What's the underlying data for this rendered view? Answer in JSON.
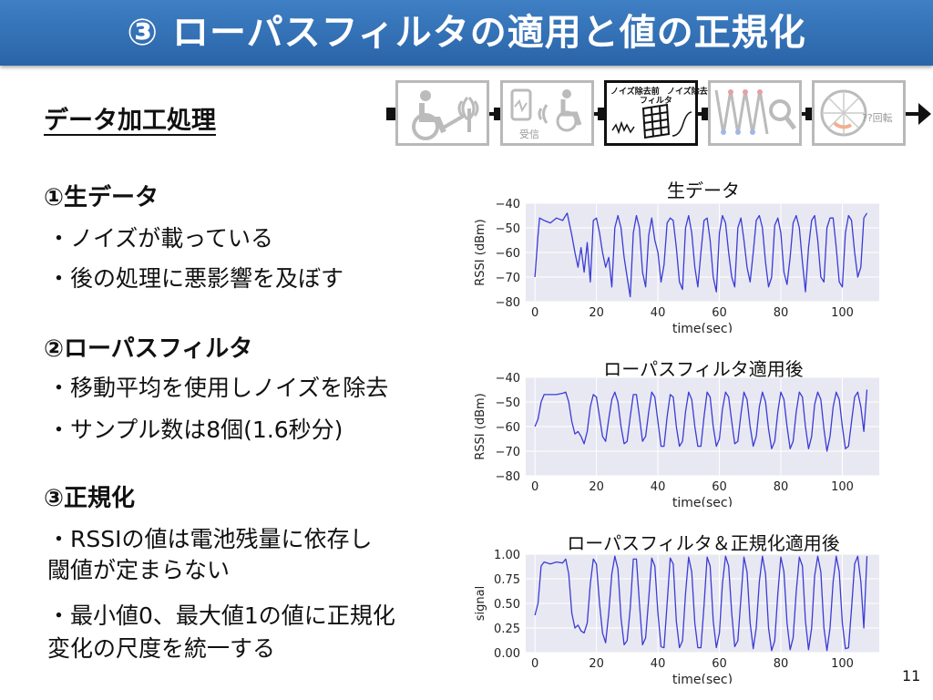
{
  "title": "③ ローパスフィルタの適用と値の正規化",
  "subtitle": "データ加工処理",
  "pipeline": {
    "stage2_label": "受信",
    "stage3_labels": [
      "ノイズ除去前",
      "フィルタ",
      "ノイズ除去後"
    ],
    "stage5_label": "??回転"
  },
  "sections": [
    {
      "heading": "①生データ",
      "bullets": [
        "・ノイズが載っている",
        "・後の処理に悪影響を及ぼす"
      ]
    },
    {
      "heading": "②ローパスフィルタ",
      "bullets": [
        "・移動平均を使用しノイズを除去",
        "・サンプル数は8個(1.6秒分)"
      ]
    },
    {
      "heading": "③正規化",
      "bullets": [
        "・RSSIの値は電池残量に依存し",
        "  閾値が定まらない",
        "・最小値0、最大値1の値に正規化",
        "  変化の尺度を統一する"
      ]
    }
  ],
  "page_number": "11",
  "colors": {
    "title_bar": "#3570b8",
    "line": "#3b3bd6",
    "plot_bg": "#e8e8f2"
  },
  "chart_data": [
    {
      "type": "line",
      "title": "生データ",
      "xlabel": "time(sec)",
      "ylabel": "RSSI (dBm)",
      "xlim": [
        -3,
        112
      ],
      "ylim": [
        -80,
        -40
      ],
      "xticks": [
        0,
        20,
        40,
        60,
        80,
        100
      ],
      "yticks": [
        -40,
        -50,
        -60,
        -70,
        -80
      ],
      "grid": true,
      "x": [
        0,
        1,
        1.5,
        3,
        5,
        7,
        9,
        10.5,
        12,
        13,
        14,
        15,
        16,
        17,
        18,
        19,
        20,
        21,
        22,
        23,
        24,
        25,
        26,
        27,
        28,
        29,
        30,
        31,
        32,
        33,
        34,
        35,
        36,
        37,
        38,
        39,
        40,
        41,
        42,
        43,
        44,
        45,
        46,
        47,
        48,
        49,
        50,
        51,
        52,
        53,
        54,
        55,
        56,
        57,
        58,
        59,
        60,
        61,
        62,
        63,
        64,
        65,
        66,
        67,
        68,
        69,
        70,
        71,
        72,
        73,
        74,
        75,
        76,
        77,
        78,
        79,
        80,
        81,
        82,
        83,
        84,
        85,
        86,
        87,
        88,
        89,
        90,
        91,
        92,
        93,
        94,
        95,
        96,
        97,
        98,
        99,
        100,
        101,
        102,
        103,
        104,
        105,
        106,
        107,
        108
      ],
      "y": [
        -70,
        -53,
        -46,
        -47,
        -48,
        -46,
        -47,
        -44,
        -53,
        -60,
        -66,
        -58,
        -68,
        -56,
        -72,
        -47,
        -46,
        -52,
        -60,
        -66,
        -62,
        -74,
        -50,
        -45,
        -50,
        -62,
        -70,
        -78,
        -52,
        -45,
        -50,
        -68,
        -74,
        -53,
        -46,
        -55,
        -60,
        -72,
        -65,
        -48,
        -46,
        -47,
        -58,
        -72,
        -75,
        -50,
        -45,
        -52,
        -66,
        -74,
        -60,
        -47,
        -46,
        -55,
        -70,
        -76,
        -52,
        -45,
        -48,
        -60,
        -70,
        -74,
        -50,
        -46,
        -55,
        -66,
        -72,
        -60,
        -47,
        -45,
        -50,
        -64,
        -74,
        -70,
        -49,
        -46,
        -52,
        -68,
        -73,
        -62,
        -48,
        -45,
        -50,
        -64,
        -76,
        -58,
        -47,
        -45,
        -55,
        -70,
        -72,
        -50,
        -46,
        -46,
        -58,
        -72,
        -74,
        -52,
        -45,
        -47,
        -60,
        -70,
        -66,
        -46,
        -44,
        -47,
        -55
      ]
    },
    {
      "type": "line",
      "title": "ローパスフィルタ適用後",
      "xlabel": "time(sec)",
      "ylabel": "RSSI (dBm)",
      "xlim": [
        -3,
        112
      ],
      "ylim": [
        -80,
        -40
      ],
      "xticks": [
        0,
        20,
        40,
        60,
        80,
        100
      ],
      "yticks": [
        -40,
        -50,
        -60,
        -70,
        -80
      ],
      "grid": true,
      "x": [
        0,
        1,
        2,
        3,
        5,
        7,
        9,
        10,
        11,
        12,
        13,
        14,
        15,
        16,
        17,
        18,
        19,
        20,
        21,
        22,
        23,
        24,
        25,
        26,
        27,
        28,
        29,
        30,
        31,
        32,
        33,
        34,
        35,
        36,
        37,
        38,
        39,
        40,
        41,
        42,
        43,
        44,
        45,
        46,
        47,
        48,
        49,
        50,
        51,
        52,
        53,
        54,
        55,
        56,
        57,
        58,
        59,
        60,
        61,
        62,
        63,
        64,
        65,
        66,
        67,
        68,
        69,
        70,
        71,
        72,
        73,
        74,
        75,
        76,
        77,
        78,
        79,
        80,
        81,
        82,
        83,
        84,
        85,
        86,
        87,
        88,
        89,
        90,
        91,
        92,
        93,
        94,
        95,
        96,
        97,
        98,
        99,
        100,
        101,
        102,
        103,
        104,
        105,
        106,
        107,
        108
      ],
      "y": [
        -60,
        -57,
        -50,
        -47,
        -47,
        -47,
        -46.5,
        -46,
        -50,
        -58,
        -63,
        -62,
        -64,
        -67,
        -62,
        -52,
        -47,
        -48,
        -56,
        -64,
        -66,
        -57,
        -49,
        -46,
        -50,
        -60,
        -67,
        -66,
        -56,
        -47,
        -47,
        -56,
        -66,
        -64,
        -54,
        -46,
        -48,
        -58,
        -68,
        -68,
        -56,
        -47,
        -48,
        -60,
        -68,
        -66,
        -54,
        -46,
        -49,
        -60,
        -68,
        -68,
        -56,
        -46,
        -48,
        -60,
        -68,
        -65,
        -53,
        -46,
        -48,
        -58,
        -67,
        -66,
        -55,
        -46,
        -49,
        -60,
        -68,
        -64,
        -52,
        -46,
        -50,
        -61,
        -69,
        -66,
        -54,
        -46,
        -49,
        -60,
        -69,
        -66,
        -54,
        -46,
        -48,
        -60,
        -69,
        -64,
        -51,
        -46,
        -49,
        -61,
        -70,
        -64,
        -52,
        -46,
        -49,
        -60,
        -69,
        -68,
        -58,
        -48,
        -46,
        -52,
        -62,
        -45
      ]
    },
    {
      "type": "line",
      "title": "ローパスフィルタ＆正規化適用後",
      "xlabel": "time(sec)",
      "ylabel": "signal",
      "xlim": [
        -3,
        112
      ],
      "ylim": [
        0,
        1
      ],
      "xticks": [
        0,
        20,
        40,
        60,
        80,
        100
      ],
      "yticks": [
        1.0,
        0.75,
        0.5,
        0.25,
        0.0
      ],
      "ytick_labels": [
        "1.00",
        "0.75",
        "0.50",
        "0.25",
        "0.00"
      ],
      "grid": true,
      "x": [
        0,
        1,
        2,
        3,
        5,
        7,
        9,
        10,
        11,
        12,
        13,
        14,
        15,
        16,
        17,
        18,
        19,
        20,
        21,
        22,
        23,
        24,
        25,
        26,
        27,
        28,
        29,
        30,
        31,
        32,
        33,
        34,
        35,
        36,
        37,
        38,
        39,
        40,
        41,
        42,
        43,
        44,
        45,
        46,
        47,
        48,
        49,
        50,
        51,
        52,
        53,
        54,
        55,
        56,
        57,
        58,
        59,
        60,
        61,
        62,
        63,
        64,
        65,
        66,
        67,
        68,
        69,
        70,
        71,
        72,
        73,
        74,
        75,
        76,
        77,
        78,
        79,
        80,
        81,
        82,
        83,
        84,
        85,
        86,
        87,
        88,
        89,
        90,
        91,
        92,
        93,
        94,
        95,
        96,
        97,
        98,
        99,
        100,
        101,
        102,
        103,
        104,
        105,
        106,
        107,
        108
      ],
      "y": [
        0.38,
        0.5,
        0.88,
        0.92,
        0.9,
        0.92,
        0.91,
        0.95,
        0.8,
        0.4,
        0.25,
        0.28,
        0.22,
        0.2,
        0.3,
        0.7,
        0.95,
        0.9,
        0.5,
        0.2,
        0.1,
        0.4,
        0.8,
        0.98,
        0.85,
        0.35,
        0.08,
        0.12,
        0.45,
        0.95,
        0.95,
        0.5,
        0.08,
        0.15,
        0.55,
        0.96,
        0.88,
        0.4,
        0.06,
        0.05,
        0.5,
        0.96,
        0.9,
        0.32,
        0.05,
        0.12,
        0.6,
        0.97,
        0.82,
        0.3,
        0.05,
        0.05,
        0.48,
        0.97,
        0.88,
        0.32,
        0.05,
        0.2,
        0.7,
        0.98,
        0.88,
        0.4,
        0.06,
        0.12,
        0.55,
        0.97,
        0.82,
        0.3,
        0.04,
        0.25,
        0.72,
        0.98,
        0.8,
        0.25,
        0.02,
        0.12,
        0.6,
        0.97,
        0.82,
        0.3,
        0.03,
        0.15,
        0.62,
        0.97,
        0.88,
        0.32,
        0.03,
        0.25,
        0.78,
        0.98,
        0.82,
        0.25,
        0.02,
        0.25,
        0.72,
        0.98,
        0.82,
        0.3,
        0.04,
        0.05,
        0.45,
        0.9,
        0.98,
        0.72,
        0.25,
        0.98
      ]
    }
  ]
}
